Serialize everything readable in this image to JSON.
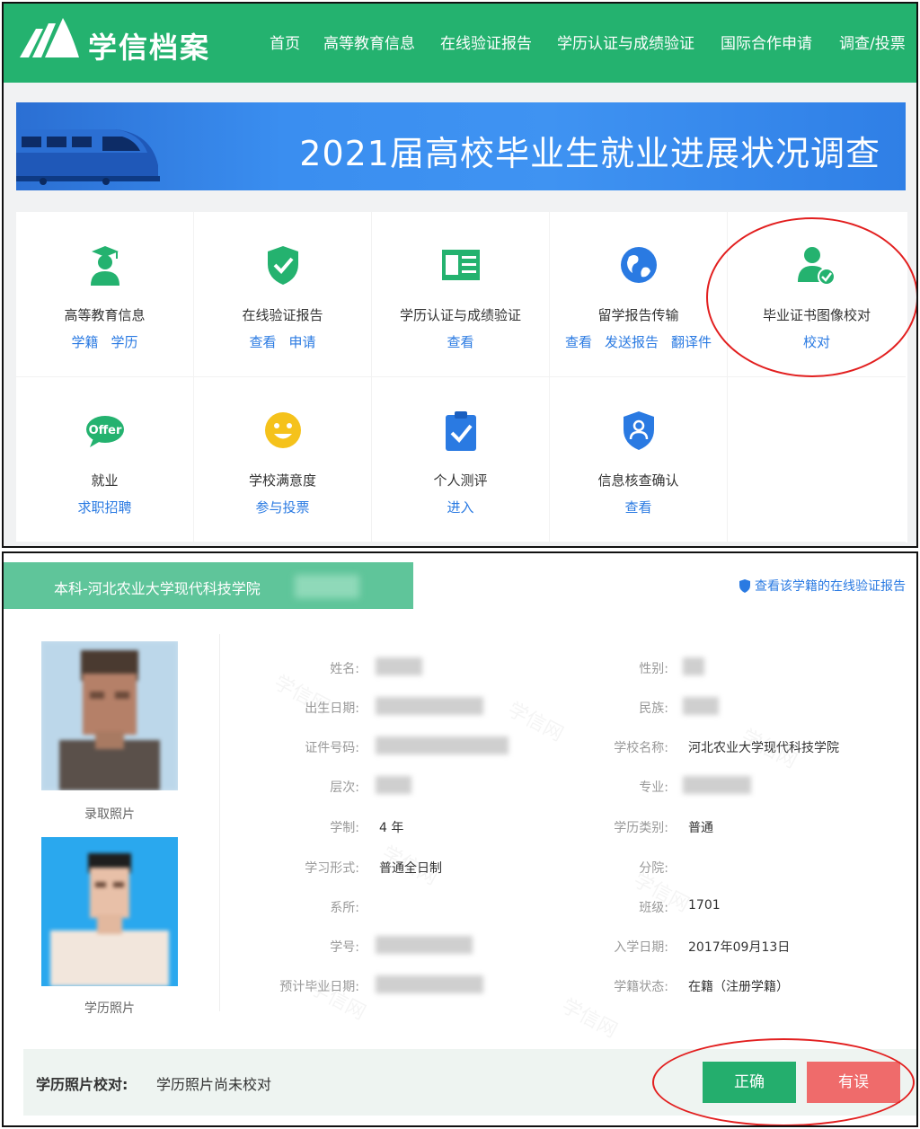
{
  "header": {
    "brand": "学信档案",
    "nav": [
      "首页",
      "高等教育信息",
      "在线验证报告",
      "学历认证与成绩验证",
      "国际合作申请",
      "调查/投票"
    ]
  },
  "banner": {
    "title": "2021届高校毕业生就业进展状况调查"
  },
  "services": [
    {
      "name": "高等教育信息",
      "links": [
        "学籍",
        "学历"
      ],
      "icon": "graduate-icon"
    },
    {
      "name": "在线验证报告",
      "links": [
        "查看",
        "申请"
      ],
      "icon": "shield-check-icon"
    },
    {
      "name": "学历认证与成绩验证",
      "links": [
        "查看"
      ],
      "icon": "id-card-icon"
    },
    {
      "name": "留学报告传输",
      "links": [
        "查看",
        "发送报告",
        "翻译件"
      ],
      "icon": "globe-icon"
    },
    {
      "name": "毕业证书图像校对",
      "links": [
        "校对"
      ],
      "icon": "user-check-icon"
    },
    {
      "name": "就业",
      "links": [
        "求职招聘"
      ],
      "icon": "offer-icon",
      "icon_text": "Offer"
    },
    {
      "name": "学校满意度",
      "links": [
        "参与投票"
      ],
      "icon": "smile-icon"
    },
    {
      "name": "个人测评",
      "links": [
        "进入"
      ],
      "icon": "clipboard-check-icon"
    },
    {
      "name": "信息核查确认",
      "links": [
        "查看"
      ],
      "icon": "user-shield-icon"
    }
  ],
  "record": {
    "tag": "本科-河北农业大学现代科技学院",
    "verify_link": "查看该学籍的在线验证报告",
    "photo_captions": [
      "录取照片",
      "学历照片"
    ],
    "left_fields": [
      {
        "label": "姓名:",
        "value": ""
      },
      {
        "label": "出生日期:",
        "value": ""
      },
      {
        "label": "证件号码:",
        "value": ""
      },
      {
        "label": "层次:",
        "value": ""
      },
      {
        "label": "学制:",
        "value": "4 年"
      },
      {
        "label": "学习形式:",
        "value": "普通全日制"
      },
      {
        "label": "系所:",
        "value": ""
      },
      {
        "label": "学号:",
        "value": ""
      },
      {
        "label": "预计毕业日期:",
        "value": ""
      }
    ],
    "right_fields": [
      {
        "label": "性别:",
        "value": ""
      },
      {
        "label": "民族:",
        "value": ""
      },
      {
        "label": "学校名称:",
        "value": "河北农业大学现代科技学院"
      },
      {
        "label": "专业:",
        "value": ""
      },
      {
        "label": "学历类别:",
        "value": "普通"
      },
      {
        "label": "分院:",
        "value": ""
      },
      {
        "label": "班级:",
        "value": "1701"
      },
      {
        "label": "入学日期:",
        "value": "2017年09月13日"
      },
      {
        "label": "学籍状态:",
        "value": "在籍（注册学籍）"
      }
    ],
    "photo_check_label": "学历照片校对:",
    "photo_check_status": "学历照片尚未校对",
    "btn_correct": "正确",
    "btn_wrong": "有误"
  },
  "colors": {
    "brand_green": "#24b26f",
    "link_blue": "#2a7ae2",
    "error_red": "#ef6b6b",
    "annotation_red": "#e21f1f"
  }
}
